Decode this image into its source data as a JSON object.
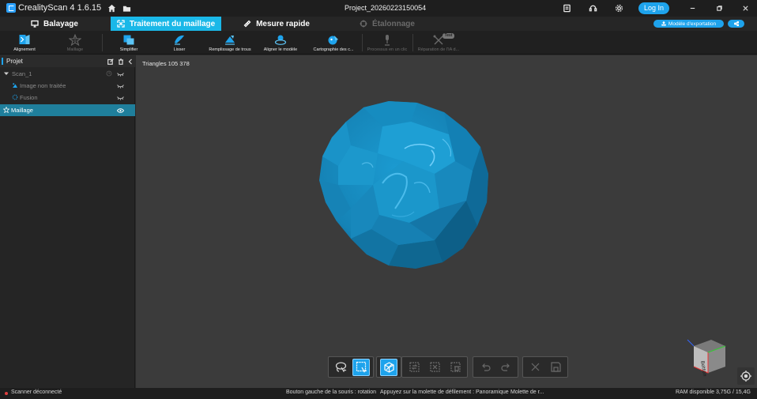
{
  "titlebar": {
    "app_title": "CrealityScan 4 1.6.15",
    "project_name": "Project_20260223150054",
    "login_label": "Log In",
    "icons": [
      "home-icon",
      "folder-icon",
      "note-icon",
      "headset-icon",
      "settings-icon",
      "minimize-icon",
      "restore-icon",
      "close-icon"
    ]
  },
  "tabs": [
    {
      "label": "Balayage",
      "icon": "monitor-icon",
      "state": "normal"
    },
    {
      "label": "Traitement du maillage",
      "icon": "mesh-icon",
      "state": "active"
    },
    {
      "label": "Mesure rapide",
      "icon": "ruler-icon",
      "state": "normal"
    },
    {
      "label": "Étalonnage",
      "icon": "target-icon",
      "state": "disabled"
    }
  ],
  "export": {
    "label": "Modèle d'exportation",
    "share_icon": "share-icon"
  },
  "toolbar": {
    "tools": [
      {
        "label": "Alignement",
        "icon": "align-icon",
        "enabled": true
      },
      {
        "label": "Maillage",
        "icon": "star-mesh-icon",
        "enabled": false
      },
      {
        "label": "Simplifier",
        "icon": "simplify-icon",
        "enabled": true
      },
      {
        "label": "Lisser",
        "icon": "smooth-icon",
        "enabled": true
      },
      {
        "label": "Remplissage de trous",
        "icon": "fill-holes-icon",
        "enabled": true
      },
      {
        "label": "Aligner le modèle",
        "icon": "align-model-icon",
        "enabled": true
      },
      {
        "label": "Cartographie des c...",
        "icon": "texture-map-icon",
        "enabled": true
      },
      {
        "label": "Processus en un clic",
        "icon": "one-click-icon",
        "enabled": false
      },
      {
        "label": "Réparation de l'IA d...",
        "icon": "ai-repair-icon",
        "enabled": false
      }
    ],
    "badge": "Test"
  },
  "panel": {
    "title": "Projet",
    "items": [
      {
        "label": "Scan_1",
        "level": 0
      },
      {
        "label": "Image non traitée",
        "level": 1
      },
      {
        "label": "Fusion",
        "level": 1
      },
      {
        "label": "Maillage",
        "level": 0
      }
    ]
  },
  "viewport": {
    "triangles": "Triangles 105 378",
    "navcube_face": "Bottom",
    "mesh_color": "#1a8fc2"
  },
  "bottom_tools": [
    {
      "name": "lasso-select-icon"
    },
    {
      "name": "rect-select-icon"
    },
    {
      "name": "select-through-icon"
    },
    {
      "name": "invert-select-icon"
    },
    {
      "name": "clear-select-icon"
    },
    {
      "name": "delete-select-icon"
    },
    {
      "name": "undo-icon"
    },
    {
      "name": "redo-icon"
    },
    {
      "name": "cancel-icon"
    },
    {
      "name": "save-icon"
    }
  ],
  "status": {
    "connection": "Scanner déconnecté",
    "hint1": "Bouton gauche de la souris : rotation",
    "hint2": "Appuyez sur la molette de défilement : Panoramique",
    "hint3": "Molette de r...",
    "ram": "RAM disponible 3,75G / 15,4G"
  },
  "colors": {
    "accent": "#1ea3ec",
    "active_tab": "#1ab8e8",
    "selected_row": "#1f7f9c"
  }
}
